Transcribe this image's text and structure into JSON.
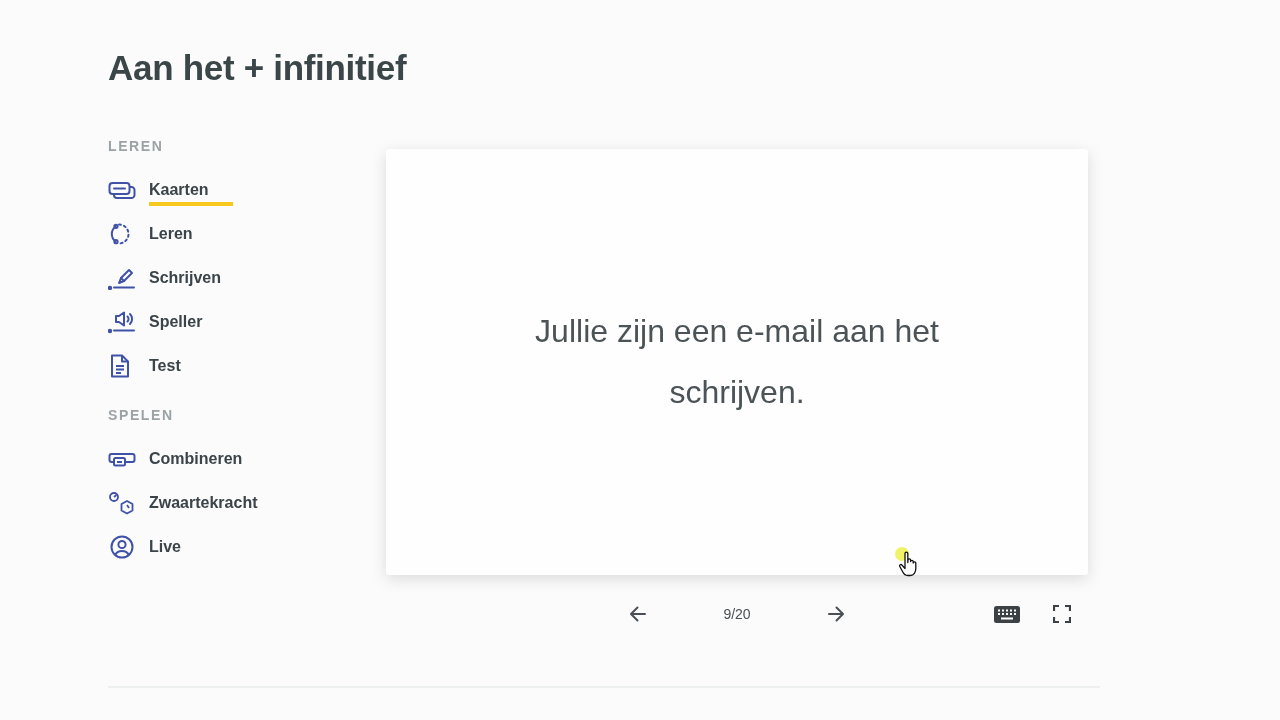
{
  "title": "Aan het + infinitief",
  "sidebar": [
    {
      "heading": "LEREN",
      "items": [
        {
          "kind": "cards",
          "label": "Kaarten",
          "selected": true
        },
        {
          "kind": "learn",
          "label": "Leren",
          "selected": false
        },
        {
          "kind": "write",
          "label": "Schrijven",
          "selected": false
        },
        {
          "kind": "spell",
          "label": "Speller",
          "selected": false
        },
        {
          "kind": "test",
          "label": "Test",
          "selected": false
        }
      ]
    },
    {
      "heading": "SPELEN",
      "items": [
        {
          "kind": "match",
          "label": "Combineren",
          "selected": false
        },
        {
          "kind": "gravity",
          "label": "Zwaartekracht",
          "selected": false
        },
        {
          "kind": "live",
          "label": "Live",
          "selected": false
        }
      ]
    }
  ],
  "flashcard": {
    "text": "Jullie zijn een e-mail aan het schrijven."
  },
  "controls": {
    "counter": "9/20"
  }
}
